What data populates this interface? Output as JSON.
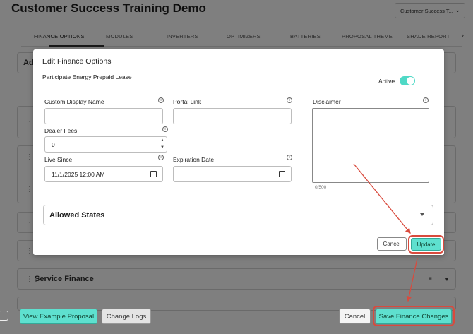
{
  "page": {
    "title": "Customer Success Training Demo",
    "org_select": "Customer Success T...",
    "tabs": [
      "FINANCE OPTIONS",
      "MODULES",
      "INVERTERS",
      "OPTIMIZERS",
      "BATTERIES",
      "PROPOSAL THEME",
      "SHADE REPORT"
    ],
    "partial_label_1": "Ad",
    "service_finance": "Service Finance",
    "view_example": "View Example Proposal",
    "change_logs": "Change Logs",
    "cancel": "Cancel",
    "save": "Save Finance Changes"
  },
  "modal": {
    "title": "Edit Finance Options",
    "subtitle": "Participate Energy Prepaid Lease",
    "active_label": "Active",
    "active": true,
    "custom_display_name": {
      "label": "Custom Display Name",
      "value": ""
    },
    "portal_link": {
      "label": "Portal Link",
      "value": ""
    },
    "disclaimer": {
      "label": "Disclaimer",
      "value": "",
      "counter": "0/500"
    },
    "dealer_fees": {
      "label": "Dealer Fees",
      "value": "0"
    },
    "live_since": {
      "label": "Live Since",
      "value": "11/1/2025 12:00 AM"
    },
    "expiration_date": {
      "label": "Expiration Date",
      "value": ""
    },
    "allowed_states": "Allowed States",
    "cancel": "Cancel",
    "update": "Update"
  },
  "colors": {
    "accent": "#5ee0cf",
    "highlight": "#d94a3d"
  }
}
